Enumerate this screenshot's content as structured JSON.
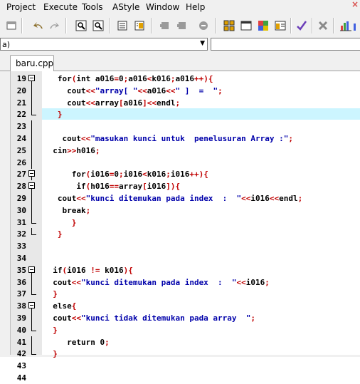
{
  "menu": [
    "Project",
    "Execute",
    "Tools",
    "AStyle",
    "Window",
    "Help"
  ],
  "close_glyph": "×",
  "compiler_combo": {
    "value": "a)",
    "arrow": "▼"
  },
  "tab": {
    "label": "baru.cpp"
  },
  "toolbar_icons": [
    "new-file-icon",
    "undo-icon",
    "redo-icon",
    "find-icon",
    "replace-icon",
    "compile-icon",
    "run-icon",
    "debug-icon",
    "breakpoint-icon",
    "stop-icon",
    "grid-icon",
    "window-icon",
    "class-browser-icon",
    "project-icon",
    "check-icon",
    "close-icon",
    "chart-icon"
  ],
  "colors": {
    "accent": "#c00000",
    "string": "#0000aa",
    "highlight": "#ccf5ff"
  },
  "editor": {
    "lines": [
      {
        "n": "19",
        "fold": "open",
        "text": "   for(int a016=0;a016<k016;a016++){",
        "indent": 0
      },
      {
        "n": "20",
        "fold": "line",
        "text": "     cout<<\"array[ \"<<a016<<\" ]  =  \";",
        "indent": 0
      },
      {
        "n": "21",
        "fold": "line",
        "text": "     cout<<array[a016]<<endl;",
        "indent": 0
      },
      {
        "n": "22",
        "fold": "end",
        "text": "   }",
        "indent": 0,
        "highlight": true
      },
      {
        "n": "23",
        "fold": "line",
        "text": "",
        "indent": 0
      },
      {
        "n": "24",
        "fold": "line",
        "text": "    cout<<\"masukan kunci untuk  penelusuran Array :\";",
        "indent": 0
      },
      {
        "n": "25",
        "fold": "line",
        "text": "  cin>>h016;",
        "indent": 0
      },
      {
        "n": "26",
        "fold": "line",
        "text": "",
        "indent": 0
      },
      {
        "n": "27",
        "fold": "open",
        "text": "      for(i016=0;i016<k016;i016++){",
        "indent": 0
      },
      {
        "n": "28",
        "fold": "open",
        "text": "       if(h016==array[i016]){",
        "indent": 0
      },
      {
        "n": "29",
        "fold": "line",
        "text": "   cout<<\"kunci ditemukan pada index  :  \"<<i016<<endl;",
        "indent": 0
      },
      {
        "n": "30",
        "fold": "line",
        "text": "    break;",
        "indent": 0
      },
      {
        "n": "31",
        "fold": "end",
        "text": "      }",
        "indent": 0
      },
      {
        "n": "32",
        "fold": "end",
        "text": "   }",
        "indent": 0
      },
      {
        "n": "33",
        "fold": "none",
        "text": "",
        "indent": 0
      },
      {
        "n": "34",
        "fold": "none",
        "text": "",
        "indent": 0
      },
      {
        "n": "35",
        "fold": "open",
        "text": "  if(i016 != k016){",
        "indent": 0
      },
      {
        "n": "36",
        "fold": "line",
        "text": "  cout<<\"kunci ditemukan pada index  :  \"<<i016;",
        "indent": 0
      },
      {
        "n": "37",
        "fold": "end",
        "text": "  }",
        "indent": 0
      },
      {
        "n": "38",
        "fold": "open",
        "text": "  else{",
        "indent": 0
      },
      {
        "n": "39",
        "fold": "line",
        "text": "  cout<<\"kunci tidak ditemukan pada array  \";",
        "indent": 0
      },
      {
        "n": "40",
        "fold": "end",
        "text": "  }",
        "indent": 0
      },
      {
        "n": "41",
        "fold": "line",
        "text": "     return 0;",
        "indent": 0
      },
      {
        "n": "42",
        "fold": "end",
        "text": "  }",
        "indent": 0
      },
      {
        "n": "43",
        "fold": "none",
        "text": "",
        "indent": 0
      },
      {
        "n": "44",
        "fold": "none",
        "text": "",
        "indent": 0
      }
    ]
  }
}
